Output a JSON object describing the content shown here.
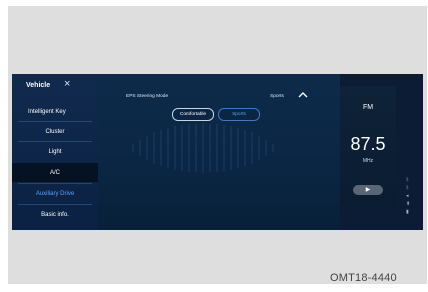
{
  "sidebar": {
    "title": "Vehicle",
    "items": [
      {
        "label": "Intelligent Key"
      },
      {
        "label": "Cluster"
      },
      {
        "label": "Light"
      },
      {
        "label": "A/C"
      },
      {
        "label": "Auxiliary Drive"
      },
      {
        "label": "Basic info."
      }
    ]
  },
  "main": {
    "mode_label": "EPS Steering Mode",
    "mode_value": "Sports",
    "options": [
      {
        "label": "Comfortable"
      },
      {
        "label": "Sports"
      }
    ]
  },
  "radio": {
    "band": "FM",
    "frequency": "87.5",
    "unit": "MHz"
  },
  "caption": "OMT18-4440"
}
